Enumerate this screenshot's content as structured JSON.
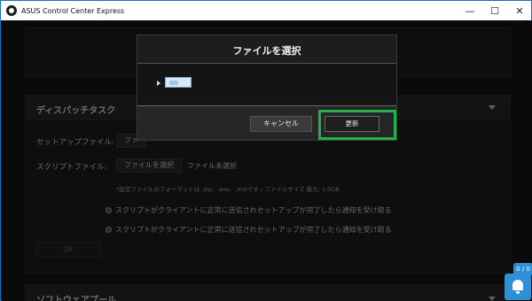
{
  "window": {
    "title": "ASUS Control Center Express",
    "minimize_glyph": "—",
    "maximize_glyph": "☐",
    "close_glyph": "✕"
  },
  "dispatch": {
    "title": "ディスパッチタスク",
    "setup_label": "セットアップファイル:",
    "setup_button": "ファ",
    "script_label": "スクリプトファイル:",
    "script_button": "ファイルを選択",
    "script_status": "ファイル未選択",
    "note": "*設定ファイルのフォーマットは .zip、.exe、.msiです / ファイルサイズ 最大: 1.0GB",
    "radio_1": "スクリプトがクライアントに正常に送信されセットアップが完了したら通知を受け取る",
    "radio_2": "スクリプトがクライアントに正常に送信されセットアップが完了したら通知を受け取る",
    "ok_button": "OK"
  },
  "software_pool": {
    "title": "ソフトウェアプール"
  },
  "dialog": {
    "title": "ファイルを選択",
    "cancel_button": "キャンセル",
    "update_button": "更新"
  },
  "notifications": {
    "count": "0 / 0"
  },
  "colors": {
    "highlight": "#22b04a",
    "accent": "#2d8fd6"
  }
}
